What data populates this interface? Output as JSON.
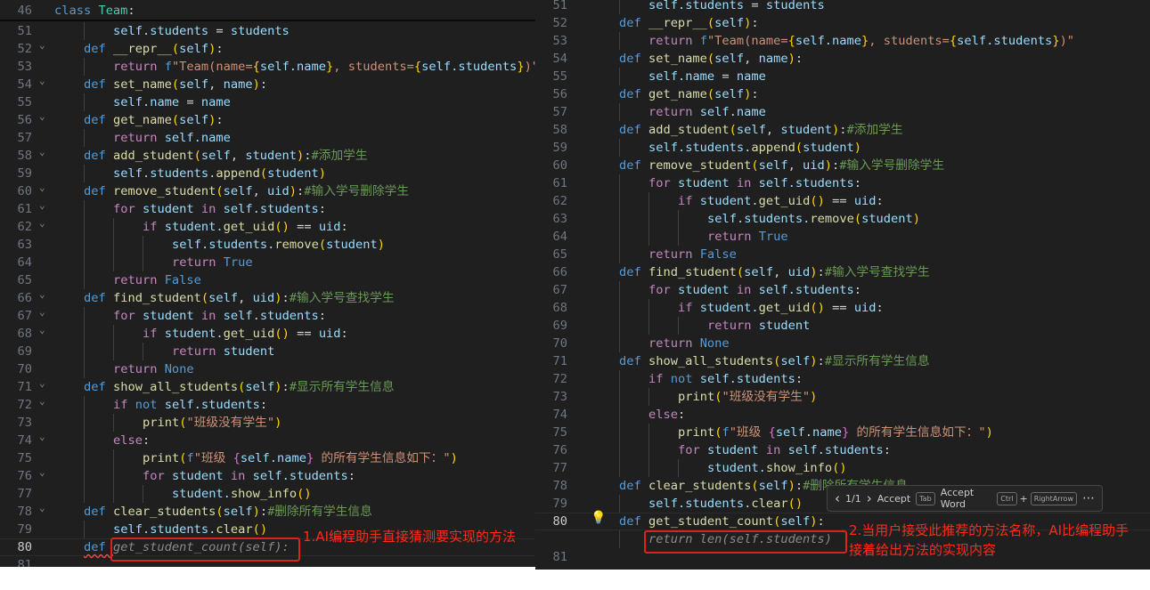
{
  "sticky": {
    "n": "46",
    "tokens": [
      [
        "class ",
        "k"
      ],
      [
        "Team",
        "cl"
      ],
      [
        ":",
        "p"
      ]
    ]
  },
  "code_lines": [
    {
      "n": "51",
      "i": 2,
      "t": [
        [
          "self.students",
          "v"
        ],
        [
          " = ",
          "p"
        ],
        [
          "students",
          "v"
        ]
      ]
    },
    {
      "n": "52",
      "i": 1,
      "fold": true,
      "t": [
        [
          "def ",
          "k"
        ],
        [
          "__repr__",
          "f"
        ],
        [
          "(",
          "b"
        ],
        [
          "self",
          "v"
        ],
        [
          ")",
          "b"
        ],
        [
          ":",
          "p"
        ]
      ]
    },
    {
      "n": "53",
      "i": 2,
      "t": [
        [
          "return ",
          "c"
        ],
        [
          "f",
          "k"
        ],
        [
          "\"Team(name=",
          "str"
        ],
        [
          "{",
          "b"
        ],
        [
          "self.name",
          "v"
        ],
        [
          "}",
          "b"
        ],
        [
          ", students=",
          "str"
        ],
        [
          "{",
          "b"
        ],
        [
          "self.students",
          "v"
        ],
        [
          "}",
          "b"
        ],
        [
          ")\"",
          "str"
        ]
      ]
    },
    {
      "n": "54",
      "i": 1,
      "fold": true,
      "t": [
        [
          "def ",
          "k"
        ],
        [
          "set_name",
          "f"
        ],
        [
          "(",
          "b"
        ],
        [
          "self",
          "v"
        ],
        [
          ", ",
          "p"
        ],
        [
          "name",
          "v"
        ],
        [
          ")",
          "b"
        ],
        [
          ":",
          "p"
        ]
      ]
    },
    {
      "n": "55",
      "i": 2,
      "t": [
        [
          "self.name",
          "v"
        ],
        [
          " = ",
          "p"
        ],
        [
          "name",
          "v"
        ]
      ]
    },
    {
      "n": "56",
      "i": 1,
      "fold": true,
      "t": [
        [
          "def ",
          "k"
        ],
        [
          "get_name",
          "f"
        ],
        [
          "(",
          "b"
        ],
        [
          "self",
          "v"
        ],
        [
          ")",
          "b"
        ],
        [
          ":",
          "p"
        ]
      ]
    },
    {
      "n": "57",
      "i": 2,
      "t": [
        [
          "return ",
          "c"
        ],
        [
          "self.name",
          "v"
        ]
      ]
    },
    {
      "n": "58",
      "i": 1,
      "fold": true,
      "t": [
        [
          "def ",
          "k"
        ],
        [
          "add_student",
          "f"
        ],
        [
          "(",
          "b"
        ],
        [
          "self",
          "v"
        ],
        [
          ", ",
          "p"
        ],
        [
          "student",
          "v"
        ],
        [
          ")",
          "b"
        ],
        [
          ":",
          "p"
        ],
        [
          "#添加学生",
          "cm"
        ]
      ]
    },
    {
      "n": "59",
      "i": 2,
      "t": [
        [
          "self.students.",
          "v"
        ],
        [
          "append",
          "f"
        ],
        [
          "(",
          "b"
        ],
        [
          "student",
          "v"
        ],
        [
          ")",
          "b"
        ]
      ]
    },
    {
      "n": "60",
      "i": 1,
      "fold": true,
      "t": [
        [
          "def ",
          "k"
        ],
        [
          "remove_student",
          "f"
        ],
        [
          "(",
          "b"
        ],
        [
          "self",
          "v"
        ],
        [
          ", ",
          "p"
        ],
        [
          "uid",
          "v"
        ],
        [
          ")",
          "b"
        ],
        [
          ":",
          "p"
        ],
        [
          "#输入学号删除学生",
          "cm"
        ]
      ]
    },
    {
      "n": "61",
      "i": 2,
      "fold": true,
      "t": [
        [
          "for ",
          "c"
        ],
        [
          "student ",
          "v"
        ],
        [
          "in ",
          "c"
        ],
        [
          "self.students",
          "v"
        ],
        [
          ":",
          "p"
        ]
      ]
    },
    {
      "n": "62",
      "i": 3,
      "fold": true,
      "t": [
        [
          "if ",
          "c"
        ],
        [
          "student.",
          "v"
        ],
        [
          "get_uid",
          "f"
        ],
        [
          "()",
          "b"
        ],
        [
          " == ",
          "p"
        ],
        [
          "uid",
          "v"
        ],
        [
          ":",
          "p"
        ]
      ]
    },
    {
      "n": "63",
      "i": 4,
      "t": [
        [
          "self.students.",
          "v"
        ],
        [
          "remove",
          "f"
        ],
        [
          "(",
          "b"
        ],
        [
          "student",
          "v"
        ],
        [
          ")",
          "b"
        ]
      ]
    },
    {
      "n": "64",
      "i": 4,
      "t": [
        [
          "return ",
          "c"
        ],
        [
          "True",
          "cn"
        ]
      ]
    },
    {
      "n": "65",
      "i": 2,
      "t": [
        [
          "return ",
          "c"
        ],
        [
          "False",
          "cn"
        ]
      ]
    },
    {
      "n": "66",
      "i": 1,
      "fold": true,
      "t": [
        [
          "def ",
          "k"
        ],
        [
          "find_student",
          "f"
        ],
        [
          "(",
          "b"
        ],
        [
          "self",
          "v"
        ],
        [
          ", ",
          "p"
        ],
        [
          "uid",
          "v"
        ],
        [
          ")",
          "b"
        ],
        [
          ":",
          "p"
        ],
        [
          "#输入学号查找学生",
          "cm"
        ]
      ]
    },
    {
      "n": "67",
      "i": 2,
      "fold": true,
      "t": [
        [
          "for ",
          "c"
        ],
        [
          "student ",
          "v"
        ],
        [
          "in ",
          "c"
        ],
        [
          "self.students",
          "v"
        ],
        [
          ":",
          "p"
        ]
      ]
    },
    {
      "n": "68",
      "i": 3,
      "fold": true,
      "t": [
        [
          "if ",
          "c"
        ],
        [
          "student.",
          "v"
        ],
        [
          "get_uid",
          "f"
        ],
        [
          "()",
          "b"
        ],
        [
          " == ",
          "p"
        ],
        [
          "uid",
          "v"
        ],
        [
          ":",
          "p"
        ]
      ]
    },
    {
      "n": "69",
      "i": 4,
      "t": [
        [
          "return ",
          "c"
        ],
        [
          "student",
          "v"
        ]
      ]
    },
    {
      "n": "70",
      "i": 2,
      "t": [
        [
          "return ",
          "c"
        ],
        [
          "None",
          "cn"
        ]
      ]
    },
    {
      "n": "71",
      "i": 1,
      "fold": true,
      "t": [
        [
          "def ",
          "k"
        ],
        [
          "show_all_students",
          "f"
        ],
        [
          "(",
          "b"
        ],
        [
          "self",
          "v"
        ],
        [
          ")",
          "b"
        ],
        [
          ":",
          "p"
        ],
        [
          "#显示所有学生信息",
          "cm"
        ]
      ]
    },
    {
      "n": "72",
      "i": 2,
      "fold": true,
      "t": [
        [
          "if ",
          "c"
        ],
        [
          "not ",
          "k"
        ],
        [
          "self.students",
          "v"
        ],
        [
          ":",
          "p"
        ]
      ]
    },
    {
      "n": "73",
      "i": 3,
      "t": [
        [
          "print",
          "f"
        ],
        [
          "(",
          "b"
        ],
        [
          "\"班级没有学生\"",
          "str"
        ],
        [
          ")",
          "b"
        ]
      ]
    },
    {
      "n": "74",
      "i": 2,
      "fold": true,
      "t": [
        [
          "else",
          "c"
        ],
        [
          ":",
          "p"
        ]
      ]
    },
    {
      "n": "75",
      "i": 3,
      "t": [
        [
          "print",
          "f"
        ],
        [
          "(",
          "b"
        ],
        [
          "f",
          "k"
        ],
        [
          "\"班级 ",
          "str"
        ],
        [
          "{",
          "b2"
        ],
        [
          "self.name",
          "v"
        ],
        [
          "}",
          "b2"
        ],
        [
          " 的所有学生信息如下：\"",
          "str"
        ],
        [
          ")",
          "b"
        ]
      ]
    },
    {
      "n": "76",
      "i": 3,
      "fold": true,
      "t": [
        [
          "for ",
          "c"
        ],
        [
          "student ",
          "v"
        ],
        [
          "in ",
          "c"
        ],
        [
          "self.students",
          "v"
        ],
        [
          ":",
          "p"
        ]
      ]
    },
    {
      "n": "77",
      "i": 4,
      "t": [
        [
          "student.",
          "v"
        ],
        [
          "show_info",
          "f"
        ],
        [
          "()",
          "b"
        ]
      ]
    },
    {
      "n": "78",
      "i": 1,
      "fold": true,
      "t": [
        [
          "def ",
          "k"
        ],
        [
          "clear_students",
          "f"
        ],
        [
          "(",
          "b"
        ],
        [
          "self",
          "v"
        ],
        [
          ")",
          "b"
        ],
        [
          ":",
          "p"
        ],
        [
          "#删除所有学生信息",
          "cm"
        ]
      ]
    },
    {
      "n": "79",
      "i": 2,
      "t": [
        [
          "self.students.",
          "v"
        ],
        [
          "clear",
          "f"
        ],
        [
          "()",
          "b"
        ]
      ]
    }
  ],
  "left_line80": {
    "n": "80",
    "i": 1,
    "t": [
      [
        "def ",
        "k"
      ],
      [
        "get_student_count(self):",
        "g"
      ]
    ]
  },
  "right_line80": {
    "n": "80",
    "i": 1,
    "t": [
      [
        "def ",
        "k"
      ],
      [
        "get_student_count",
        "f"
      ],
      [
        "(",
        "b"
      ],
      [
        "self",
        "v"
      ],
      [
        ")",
        "b"
      ],
      [
        ":",
        "p"
      ]
    ]
  },
  "right_ghost": {
    "i": 2,
    "t": [
      [
        "return len(self.students)",
        "g"
      ]
    ]
  },
  "line81": "81",
  "popup": {
    "prev": "‹",
    "count": "1/1",
    "next": "›",
    "accept": "Accept",
    "accept_key": "Tab",
    "accept_word": "Accept Word",
    "ctrl_key": "Ctrl",
    "plus": "+",
    "arrow_key": "RightArrow",
    "more": "⋯"
  },
  "annotations": {
    "left": "1.AI编程助手直接猜测要实现的方法",
    "right_1": "2.当用户接受此推荐的方法名称，AI比编程助手",
    "right_2": "接着给出方法的实现内容"
  },
  "lightbulb": "💡"
}
